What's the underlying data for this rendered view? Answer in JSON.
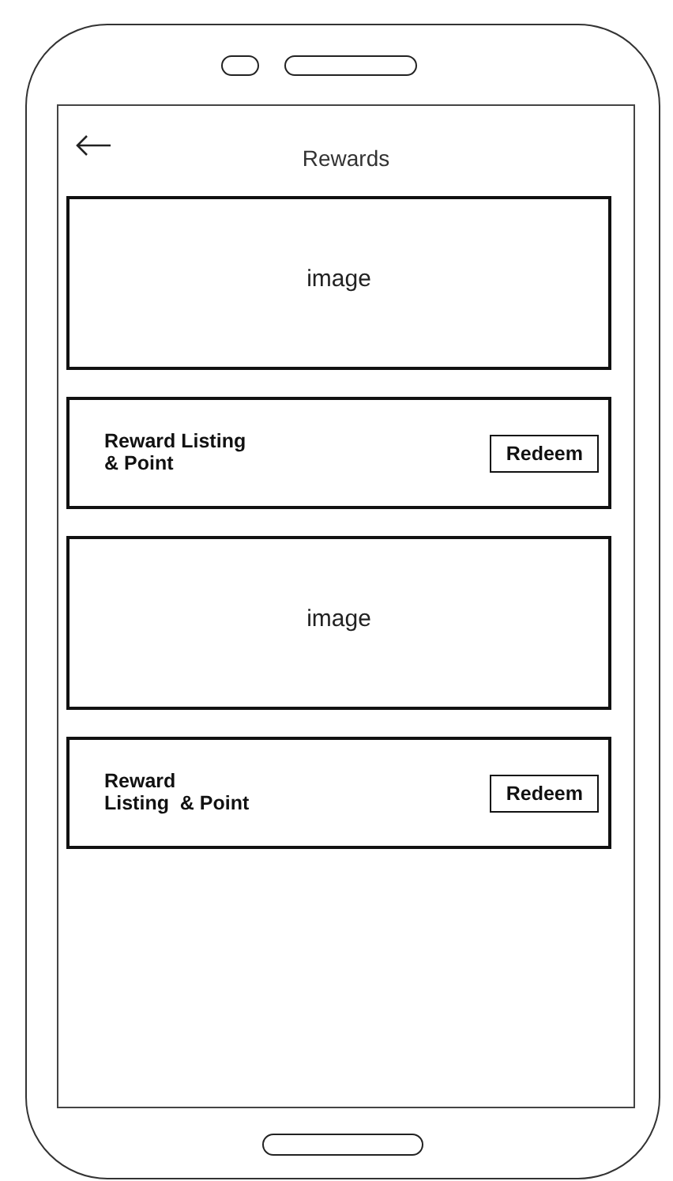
{
  "header": {
    "title": "Rewards"
  },
  "cards": [
    {
      "kind": "image",
      "label": "image"
    },
    {
      "kind": "reward",
      "title": "Reward Listing\n& Point",
      "button": "Redeem"
    },
    {
      "kind": "image",
      "label": "image"
    },
    {
      "kind": "reward",
      "title": "Reward\nListing  & Point",
      "button": "Redeem"
    }
  ]
}
